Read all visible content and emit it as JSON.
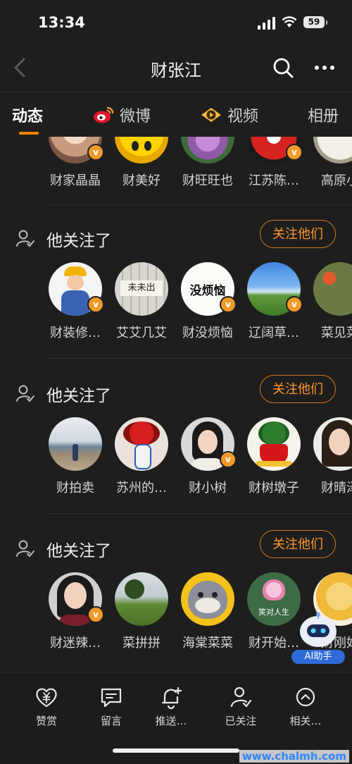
{
  "status_bar": {
    "time": "13:34",
    "battery": "59"
  },
  "header": {
    "title": "财张江"
  },
  "tabs": [
    {
      "label": "动态",
      "active": true
    },
    {
      "label": "微博"
    },
    {
      "label": "视频"
    },
    {
      "label": "相册"
    }
  ],
  "top_row": {
    "names": [
      "财家晶晶",
      "财美好",
      "财旺旺也",
      "江苏陈…",
      "高原小"
    ]
  },
  "sections": [
    {
      "title": "他关注了",
      "follow_label": "关注他们",
      "users": [
        {
          "name": "财装修…",
          "verified": true
        },
        {
          "name": "艾艾几艾",
          "verified": false
        },
        {
          "name": "财没烦恼",
          "verified": true,
          "avatar_text": "没烦恼"
        },
        {
          "name": "辽阔草…",
          "verified": true
        },
        {
          "name": "菜见菜",
          "verified": false
        }
      ]
    },
    {
      "title": "他关注了",
      "follow_label": "关注他们",
      "users": [
        {
          "name": "财拍卖",
          "verified": false
        },
        {
          "name": "苏州的…",
          "verified": false
        },
        {
          "name": "财小树",
          "verified": true
        },
        {
          "name": "财树墩子",
          "verified": false
        },
        {
          "name": "财晴泽",
          "verified": false
        }
      ]
    },
    {
      "title": "他关注了",
      "follow_label": "关注他们",
      "users": [
        {
          "name": "财迷辣…",
          "verified": true
        },
        {
          "name": "菜拼拼",
          "verified": false
        },
        {
          "name": "海棠菜菜",
          "verified": false
        },
        {
          "name": "财开始…",
          "verified": false,
          "avatar_text": "笑对人生"
        },
        {
          "name": "财刚好",
          "verified": false
        }
      ]
    }
  ],
  "bottom_bar": [
    {
      "label": "赞赏",
      "icon": "heart-yen-icon"
    },
    {
      "label": "留言",
      "icon": "comment-icon"
    },
    {
      "label": "推送…",
      "icon": "bell-plus-icon"
    },
    {
      "label": "已关注",
      "icon": "user-check-icon"
    },
    {
      "label": "相关…",
      "icon": "chevron-up-circle-icon"
    }
  ],
  "ai_helper": {
    "label": "AI助手"
  },
  "watermark": "www.chalmh.com",
  "colors": {
    "accent": "#ff8200",
    "background": "#1e1e1e",
    "verified": "#f19a2b",
    "ai": "#2f6bd6"
  }
}
